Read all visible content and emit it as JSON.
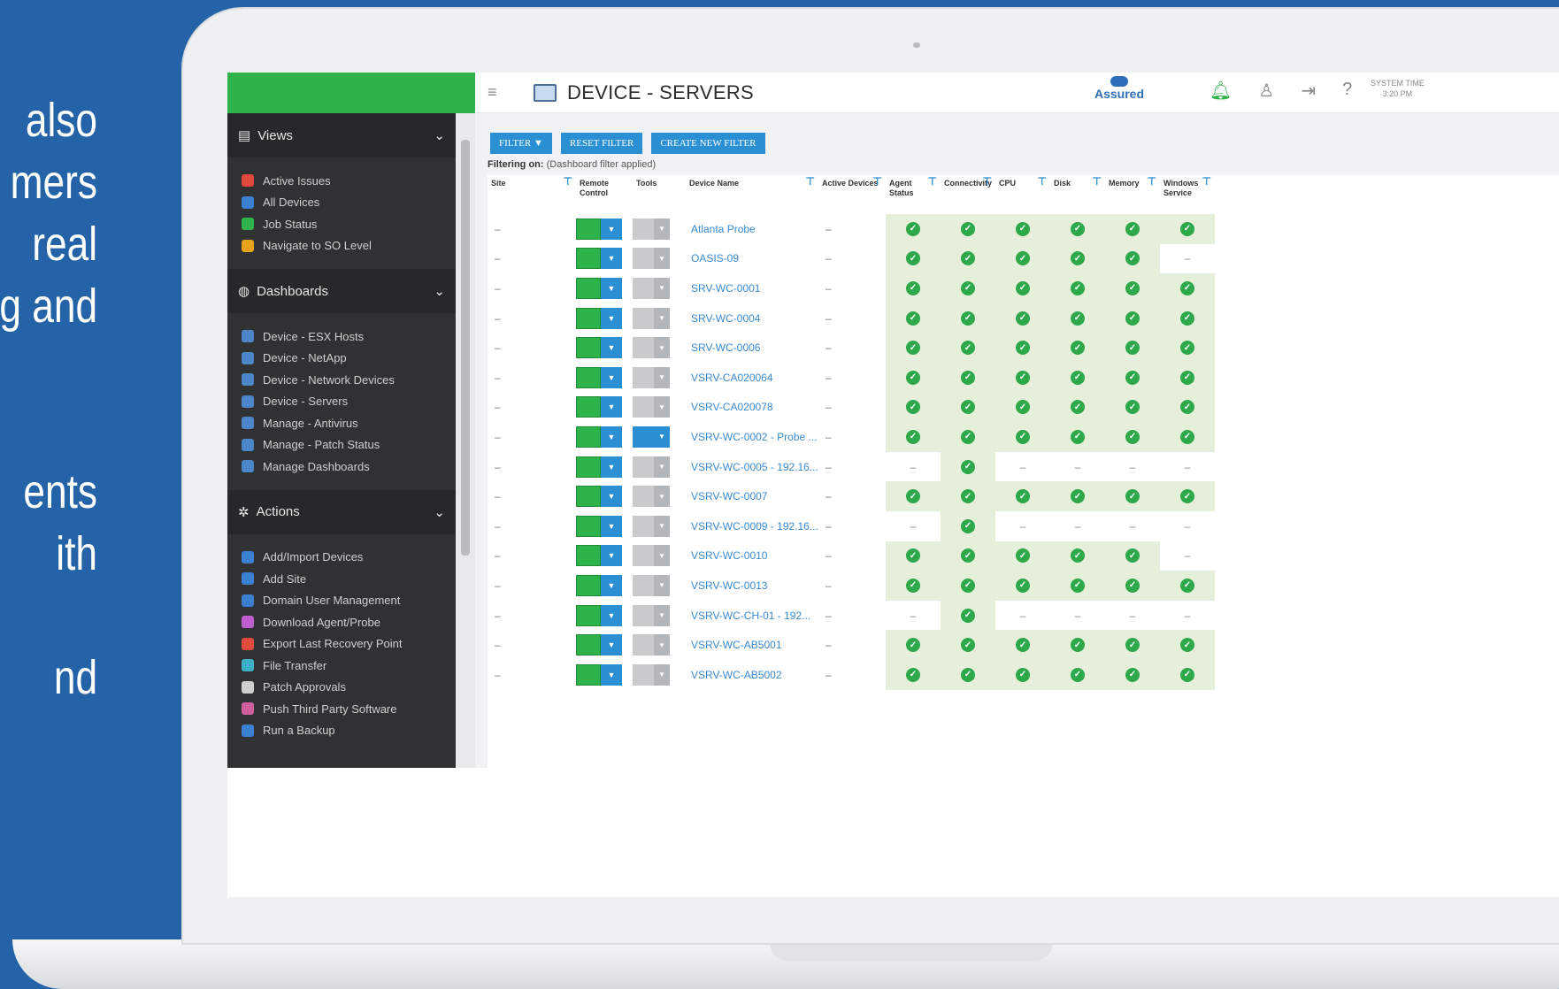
{
  "promo": [
    "also",
    "mers",
    "real",
    "g and",
    "ents",
    "ith",
    "nd"
  ],
  "topbar": {
    "title": "DEVICE - SERVERS",
    "brand": "Assured",
    "systime_line1": "SYSTEM TIME",
    "systime_line2": "3:20 PM"
  },
  "sidebar": {
    "views": {
      "label": "Views",
      "items": [
        "Active Issues",
        "All Devices",
        "Job Status",
        "Navigate to SO Level"
      ]
    },
    "dashboards": {
      "label": "Dashboards",
      "items": [
        "Device - ESX Hosts",
        "Device - NetApp",
        "Device - Network Devices",
        "Device - Servers",
        "Manage - Antivirus",
        "Manage - Patch Status",
        "Manage Dashboards"
      ]
    },
    "actions": {
      "label": "Actions",
      "items": [
        "Add/Import Devices",
        "Add Site",
        "Domain User Management",
        "Download Agent/Probe",
        "Export Last Recovery Point",
        "File Transfer",
        "Patch Approvals",
        "Push Third Party Software",
        "Run a Backup"
      ]
    }
  },
  "toolbar": {
    "filter": "FILTER ▼",
    "reset": "RESET FILTER",
    "create": "CREATE NEW FILTER",
    "filtering_label": "Filtering on:",
    "filtering_value": "(Dashboard filter applied)"
  },
  "table": {
    "headers": [
      "Site",
      "Remote Control",
      "Tools",
      "Device Name",
      "Active Devices",
      "Agent Status",
      "Connectivity",
      "CPU",
      "Disk",
      "Memory",
      "Windows Service"
    ],
    "rows": [
      {
        "device": "Atlanta Probe",
        "status": [
          1,
          1,
          1,
          1,
          1,
          1
        ],
        "tools_active": false
      },
      {
        "device": "OASIS-09",
        "status": [
          1,
          1,
          1,
          1,
          1,
          0
        ],
        "tools_active": false
      },
      {
        "device": "SRV-WC-0001",
        "status": [
          1,
          1,
          1,
          1,
          1,
          1
        ],
        "tools_active": false
      },
      {
        "device": "SRV-WC-0004",
        "status": [
          1,
          1,
          1,
          1,
          1,
          1
        ],
        "tools_active": false
      },
      {
        "device": "SRV-WC-0006",
        "status": [
          1,
          1,
          1,
          1,
          1,
          1
        ],
        "tools_active": false
      },
      {
        "device": "VSRV-CA020064",
        "status": [
          1,
          1,
          1,
          1,
          1,
          1
        ],
        "tools_active": false
      },
      {
        "device": "VSRV-CA020078",
        "status": [
          1,
          1,
          1,
          1,
          1,
          1
        ],
        "tools_active": false
      },
      {
        "device": "VSRV-WC-0002 - Probe ...",
        "status": [
          1,
          1,
          1,
          1,
          1,
          1
        ],
        "tools_active": true
      },
      {
        "device": "VSRV-WC-0005 - 192.16...",
        "status": [
          0,
          1,
          0,
          0,
          0,
          0
        ],
        "tools_active": false
      },
      {
        "device": "VSRV-WC-0007",
        "status": [
          1,
          1,
          1,
          1,
          1,
          1
        ],
        "tools_active": false
      },
      {
        "device": "VSRV-WC-0009 - 192.16...",
        "status": [
          0,
          1,
          0,
          0,
          0,
          0
        ],
        "tools_active": false
      },
      {
        "device": "VSRV-WC-0010",
        "status": [
          1,
          1,
          1,
          1,
          1,
          0
        ],
        "tools_active": false
      },
      {
        "device": "VSRV-WC-0013",
        "status": [
          1,
          1,
          1,
          1,
          1,
          1
        ],
        "tools_active": false
      },
      {
        "device": "VSRV-WC-CH-01 - 192...",
        "status": [
          0,
          1,
          0,
          0,
          0,
          0
        ],
        "tools_active": false
      },
      {
        "device": "VSRV-WC-AB5001",
        "status": [
          1,
          1,
          1,
          1,
          1,
          1
        ],
        "tools_active": false
      },
      {
        "device": "VSRV-WC-AB5002",
        "status": [
          1,
          1,
          1,
          1,
          1,
          1
        ],
        "tools_active": false
      }
    ]
  },
  "colors": {
    "accent": "#2db34a",
    "link": "#3a8ad0",
    "button": "#2b8fd3",
    "sidebar": "#2f3133",
    "background": "#2563a8"
  }
}
